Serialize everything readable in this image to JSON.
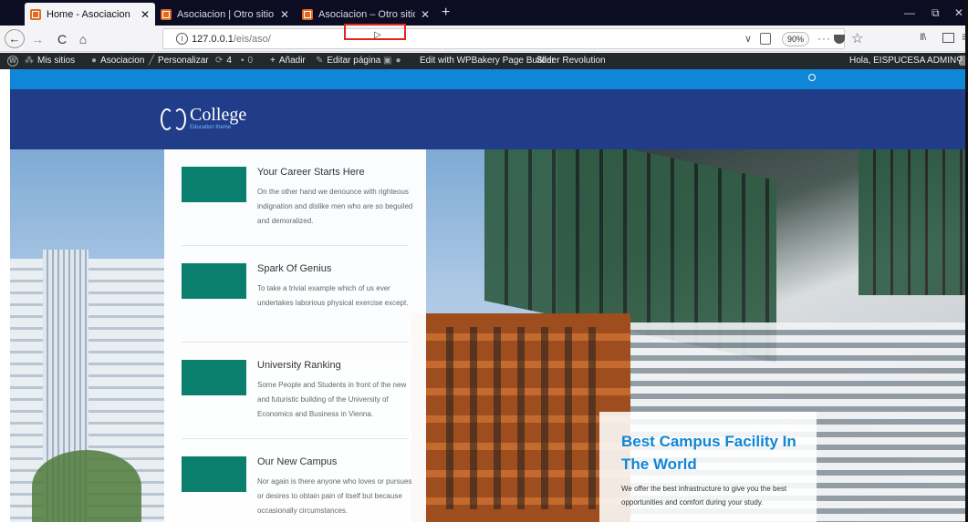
{
  "browser": {
    "tabs": [
      {
        "title": "Home - Asociacion",
        "active": true
      },
      {
        "title": "Asociacion | Otro sitio más de",
        "active": false
      },
      {
        "title": "Asociacion – Otro sitio más de",
        "active": false
      }
    ],
    "close_glyph": "✕",
    "new_tab_glyph": "+",
    "url_host": "127.0.0.1",
    "url_path": "/eis/aso/",
    "info_glyph": "i",
    "page_actions_glyph": "∨",
    "zoom": "90%",
    "more_glyph": "···",
    "star_glyph": "☆",
    "library_glyph": "II\\",
    "menu_glyph": "≡",
    "back_glyph": "←",
    "forward_glyph": "→",
    "reload_glyph": "C",
    "home_glyph": "⌂",
    "minimize_glyph": "—",
    "restore_glyph": "⧉",
    "window_close_glyph": "✕",
    "accent_highlight": "#e0261b"
  },
  "adminbar": {
    "wp_glyph": "W",
    "my_sites": "Mis sitios",
    "site": "Asociacion",
    "customize": "Personalizar",
    "updates_count": "4",
    "comments_count": "0",
    "new": "Añadir",
    "edit_page": "Editar página",
    "wpbakery": "Edit with WPBakery Page Builder",
    "slider": "Slider Revolution",
    "greeting": "Hola, EISPUCESA ADMIN",
    "search_glyph": "⚲",
    "icons": {
      "sites": "sites-icon",
      "home": "home-icon",
      "brush": "brush-icon",
      "updates": "updates-icon",
      "comments": "comments-icon",
      "plus": "plus-icon",
      "pencil": "pencil-icon"
    }
  },
  "site": {
    "logo_name": "College",
    "logo_tagline": "Education theme",
    "brand_blue": "#213d8a",
    "topbar_blue": "#0f86d6",
    "teal": "#0a7f6e",
    "features": [
      {
        "title": "Your Career Starts Here",
        "text": "On the other hand we denounce with righteous indignation and dislike men who are so beguiled and demoralized."
      },
      {
        "title": "Spark Of Genius",
        "text": "To take a trivial example which of us ever undertakes laborious physical exercise except."
      },
      {
        "title": "University Ranking",
        "text": "Some People and Students in front of the new and futuristic building of the University of Economics and Business in Vienna."
      },
      {
        "title": "Our New Campus",
        "text": "Nor again is there anyone who loves or pursues or desires to obtain pain of itself but because occasionally circumstances."
      }
    ],
    "callout": {
      "title": "Best Campus Facility In The World",
      "text": "We offer the best infrastructure to give you the best opportunities and comfort during your study."
    }
  }
}
